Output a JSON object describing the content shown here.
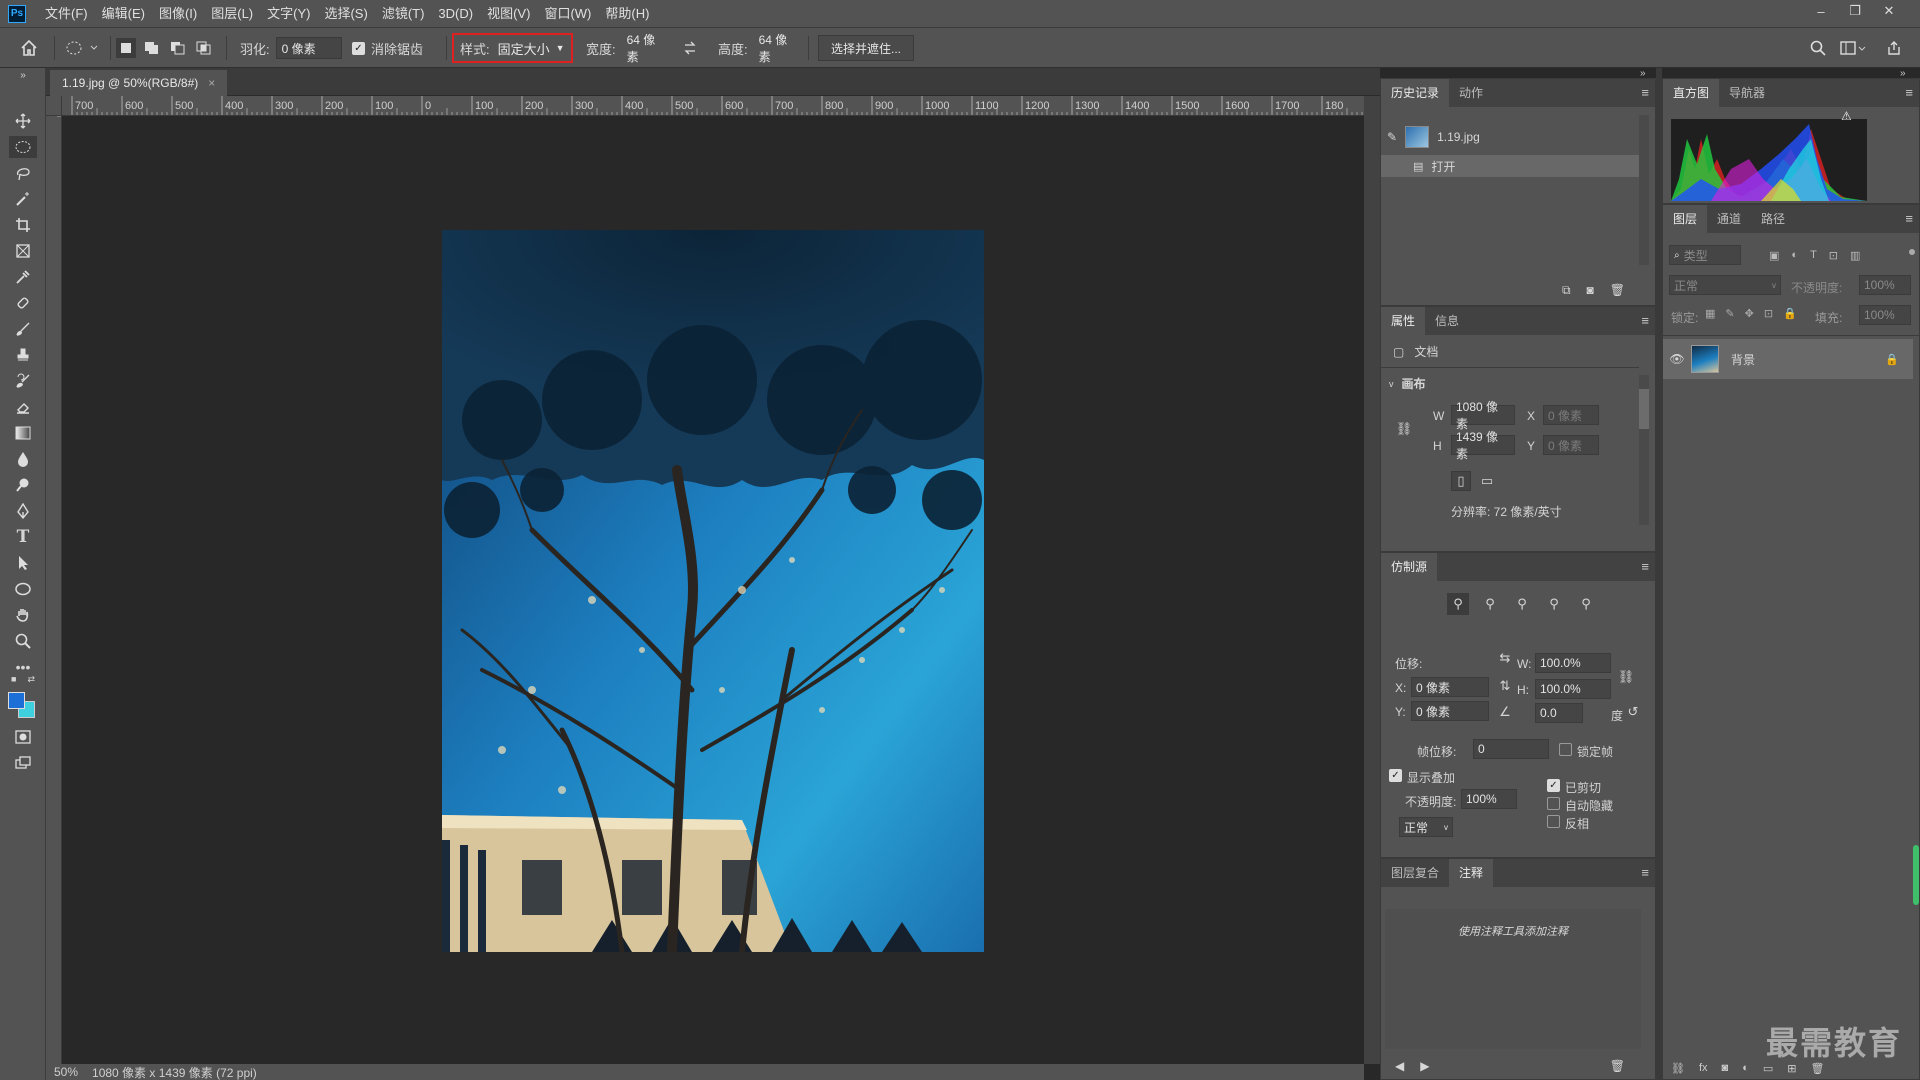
{
  "app": {
    "logo": "Ps"
  },
  "menu": [
    "文件(F)",
    "编辑(E)",
    "图像(I)",
    "图层(L)",
    "文字(Y)",
    "选择(S)",
    "滤镜(T)",
    "3D(D)",
    "视图(V)",
    "窗口(W)",
    "帮助(H)"
  ],
  "window_controls": {
    "minimize": "–",
    "restore": "❐",
    "close": "✕"
  },
  "options": {
    "feather_label": "羽化:",
    "feather_value": "0 像素",
    "antialias_label": "消除锯齿",
    "style_label": "样式:",
    "style_value": "固定大小",
    "width_label": "宽度:",
    "width_value": "64 像素",
    "height_label": "高度:",
    "height_value": "64 像素",
    "select_mask_button": "选择并遮住..."
  },
  "document": {
    "tab_title": "1.19.jpg @ 50%(RGB/8#)",
    "close": "×",
    "zoom": "50%",
    "info": "1080 像素 x 1439 像素 (72 ppi)",
    "ruler_h": [
      "700",
      "600",
      "500",
      "400",
      "300",
      "200",
      "100",
      "0",
      "100",
      "200",
      "300",
      "400",
      "500",
      "600",
      "700",
      "800",
      "900",
      "1000",
      "1100",
      "1200",
      "1300",
      "1400",
      "1500",
      "1600",
      "1700",
      "180"
    ]
  },
  "history": {
    "tabs": [
      "历史记录",
      "动作"
    ],
    "snapshot": "1.19.jpg",
    "items": [
      "打开"
    ]
  },
  "properties": {
    "tabs": [
      "属性",
      "信息"
    ],
    "doc_label": "文档",
    "canvas_label": "画布",
    "w_label": "W",
    "w_value": "1080 像素",
    "h_label": "H",
    "h_value": "1439 像素",
    "x_label": "X",
    "x_value": "0 像素",
    "y_label": "Y",
    "y_value": "0 像素",
    "resolution": "分辨率: 72 像素/英寸"
  },
  "clone_source": {
    "tab": "仿制源",
    "offset_label": "位移:",
    "x_label": "X:",
    "x_value": "0 像素",
    "y_label": "Y:",
    "y_value": "0 像素",
    "w_label": "W:",
    "w_value": "100.0%",
    "h_label": "H:",
    "h_value": "100.0%",
    "angle_value": "0.0",
    "angle_unit": "度",
    "frame_offset_label": "帧位移:",
    "frame_offset_value": "0",
    "lock_frame": "锁定帧",
    "show_overlay": "显示叠加",
    "opacity_label": "不透明度:",
    "opacity_value": "100%",
    "blend_mode": "正常",
    "clipped": "已剪切",
    "auto_hide": "自动隐藏",
    "invert": "反相"
  },
  "notes": {
    "tabs": [
      "图层复合",
      "注释"
    ],
    "hint": "使用注释工具添加注释"
  },
  "histogram": {
    "tabs": [
      "直方图",
      "导航器"
    ],
    "warning": "⚠"
  },
  "layers": {
    "tabs": [
      "图层",
      "通道",
      "路径"
    ],
    "filter_placeholder": "类型",
    "blend_mode": "正常",
    "opacity_label": "不透明度:",
    "opacity_value": "100%",
    "lock_label": "锁定:",
    "fill_label": "填充:",
    "fill_value": "100%",
    "layer_name": "背景"
  },
  "watermark": "最需教育",
  "colors": {
    "accent_red": "#e02020",
    "fg_color": "#1c6fd6",
    "bg_color": "#3fd0e0"
  }
}
